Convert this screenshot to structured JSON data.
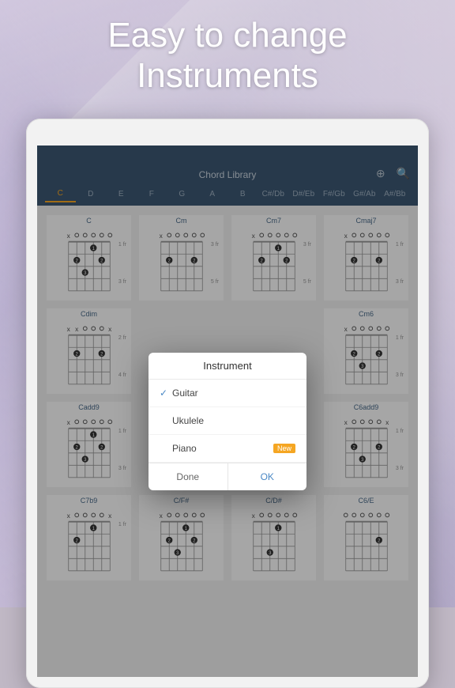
{
  "headline": "Easy to change\nInstruments",
  "appbar": {
    "title": "Chord Library"
  },
  "icons": {
    "globe": "⊕",
    "search": "🔍"
  },
  "tabs": [
    "C",
    "D",
    "E",
    "F",
    "G",
    "A",
    "B",
    "C#/Db",
    "D#/Eb",
    "F#/Gb",
    "G#/Ab",
    "A#/Bb"
  ],
  "active_tab": "C",
  "chords": [
    {
      "name": "C",
      "fr_top": "1 fr",
      "fr_bot": "3 fr",
      "mute": [
        1,
        0,
        0,
        0,
        0,
        0
      ]
    },
    {
      "name": "Cm",
      "fr_top": "3 fr",
      "fr_bot": "5 fr",
      "mute": [
        1,
        0,
        0,
        0,
        0,
        0
      ]
    },
    {
      "name": "Cm7",
      "fr_top": "3 fr",
      "fr_bot": "5 fr",
      "mute": [
        1,
        0,
        0,
        0,
        0,
        0
      ]
    },
    {
      "name": "Cmaj7",
      "fr_top": "1 fr",
      "fr_bot": "3 fr",
      "mute": [
        1,
        0,
        0,
        0,
        0,
        0
      ]
    },
    {
      "name": "Cdim",
      "fr_top": "2 fr",
      "fr_bot": "4 fr",
      "mute": [
        1,
        1,
        0,
        0,
        0,
        1
      ]
    },
    {
      "name": "",
      "fr_top": "",
      "fr_bot": "",
      "mute": [
        0,
        0,
        0,
        0,
        0,
        0
      ]
    },
    {
      "name": "",
      "fr_top": "",
      "fr_bot": "",
      "mute": [
        0,
        0,
        0,
        0,
        0,
        0
      ]
    },
    {
      "name": "Cm6",
      "fr_top": "1 fr",
      "fr_bot": "3 fr",
      "mute": [
        1,
        0,
        0,
        0,
        0,
        0
      ]
    },
    {
      "name": "Cadd9",
      "fr_top": "1 fr",
      "fr_bot": "3 fr",
      "mute": [
        1,
        0,
        0,
        0,
        0,
        0
      ]
    },
    {
      "name": "",
      "fr_top": "",
      "fr_bot": "",
      "mute": [
        0,
        0,
        0,
        0,
        0,
        0
      ]
    },
    {
      "name": "",
      "fr_top": "",
      "fr_bot": "",
      "mute": [
        0,
        0,
        0,
        0,
        0,
        0
      ]
    },
    {
      "name": "C6add9",
      "fr_top": "1 fr",
      "fr_bot": "3 fr",
      "mute": [
        1,
        0,
        0,
        0,
        0,
        1
      ]
    },
    {
      "name": "C7b9",
      "fr_top": "1 fr",
      "fr_bot": "",
      "mute": [
        1,
        0,
        0,
        0,
        0,
        1
      ]
    },
    {
      "name": "C/F#",
      "fr_top": "",
      "fr_bot": "",
      "mute": [
        1,
        0,
        0,
        0,
        0,
        0
      ]
    },
    {
      "name": "C/D#",
      "fr_top": "",
      "fr_bot": "",
      "mute": [
        1,
        0,
        0,
        0,
        0,
        0
      ]
    },
    {
      "name": "C6/E",
      "fr_top": "",
      "fr_bot": "",
      "mute": [
        0,
        0,
        0,
        0,
        0,
        0
      ]
    }
  ],
  "modal": {
    "title": "Instrument",
    "options": [
      {
        "label": "Guitar",
        "selected": true,
        "badge": null
      },
      {
        "label": "Ukulele",
        "selected": false,
        "badge": null
      },
      {
        "label": "Piano",
        "selected": false,
        "badge": "New"
      }
    ],
    "actions": {
      "done": "Done",
      "ok": "OK"
    }
  }
}
